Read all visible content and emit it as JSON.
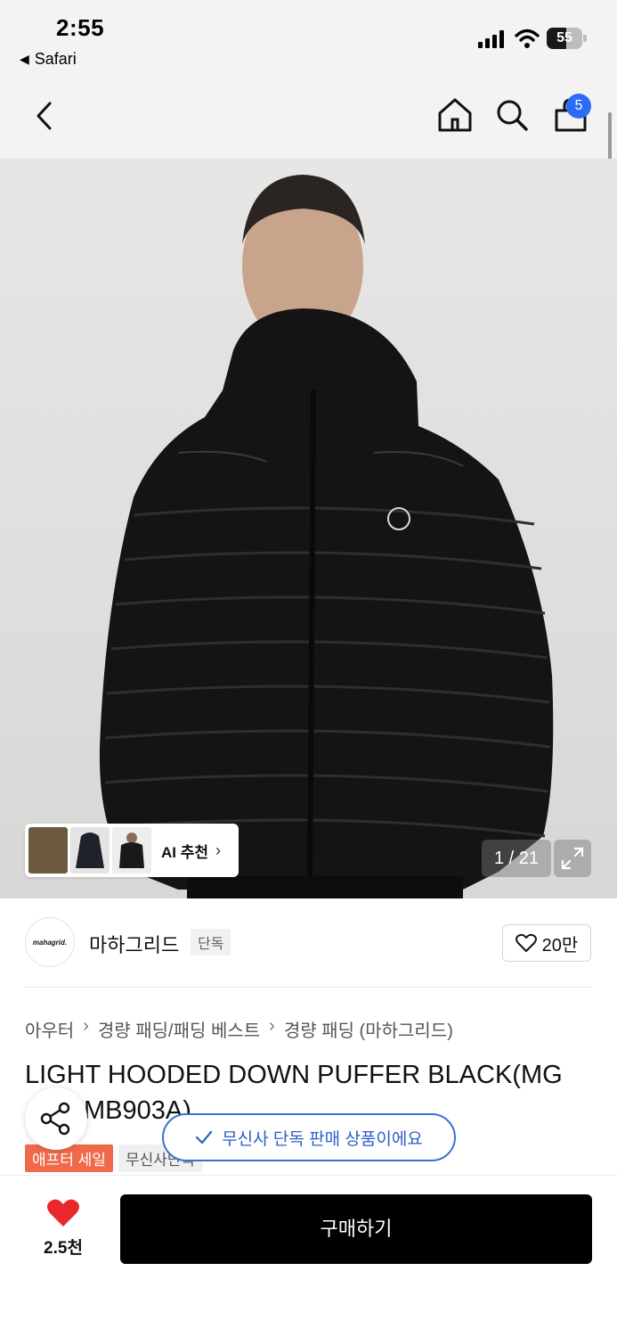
{
  "status_bar": {
    "time": "2:55",
    "back_app": "Safari",
    "battery": "55",
    "battery_level": 0.55
  },
  "nav": {
    "cart_count": "5"
  },
  "hero": {
    "page_indicator": "1 / 21",
    "ai_recommend_label": "AI 추천"
  },
  "brand": {
    "logo_text": "mahagrid.",
    "name": "마하그리드",
    "tag": "단독",
    "like_count": "20만"
  },
  "breadcrumb": [
    "아우터",
    "경량 패딩/패딩 베스트",
    "경량 패딩 (마하그리드)"
  ],
  "product": {
    "title_line1": "LIGHT HOODED DOWN PUFFER BLACK(MG",
    "title_line2": "MB903A)"
  },
  "badges": {
    "sale": "애프터 세일",
    "gray": "무신사단독"
  },
  "toast": "무신사 단독 판매 상품이에요",
  "bottom": {
    "fav_count": "2.5천",
    "buy_label": "구매하기"
  },
  "colors": {
    "accent_blue": "#2b6cf6",
    "sale_badge": "#ef6a4a",
    "heart_red": "#e8282b",
    "buy_button": "#000000"
  }
}
